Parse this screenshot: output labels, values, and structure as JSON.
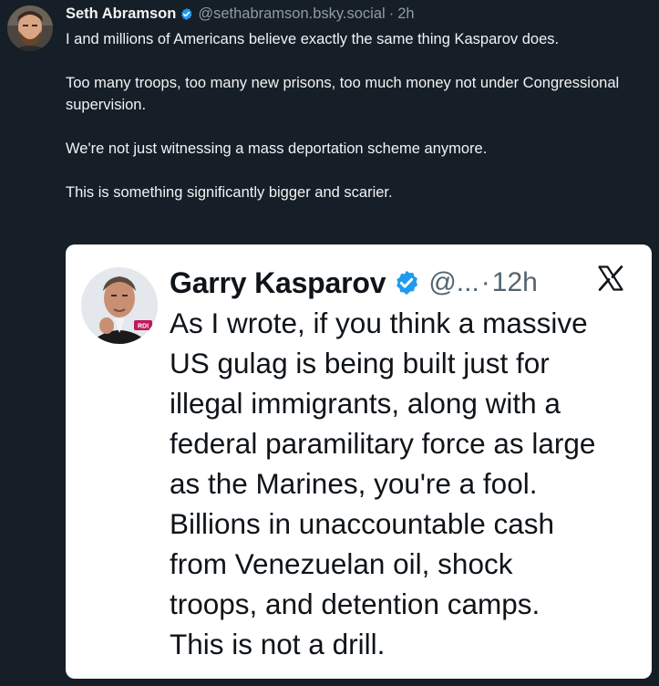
{
  "post": {
    "author": {
      "display_name": "Seth Abramson",
      "handle": "@sethabramson.bsky.social",
      "separator": "·",
      "time": "2h",
      "verified": true
    },
    "paragraphs": [
      "I and millions of Americans believe exactly the same thing Kasparov does.",
      "Too many troops, too many new prisons, too much money not under Congressional supervision.",
      "We're not just witnessing a mass deportation scheme anymore.",
      "This is something significantly bigger and scarier."
    ]
  },
  "quoted_post": {
    "author": {
      "display_name": "Garry Kasparov",
      "handle": "@...",
      "separator": "·",
      "time": "12h",
      "verified": true,
      "avatar_badge": "RDI"
    },
    "platform_icon": "x-logo-icon",
    "text_lines": [
      "As I wrote, if you think a massive",
      "US gulag is being built just for",
      "illegal immigrants, along with a",
      "federal paramilitary force as large",
      "as the Marines, you're a fool.",
      "Billions in unaccountable cash",
      "from Venezuelan oil, shock",
      "troops, and detention camps.",
      "This is not a drill."
    ]
  },
  "colors": {
    "background": "#161e27",
    "primary_text": "#f1f3f5",
    "secondary_text": "#8d9aa8",
    "verified_blue": "#1d9bf0",
    "card_background": "#ffffff",
    "card_text": "#0f1419",
    "card_secondary_text": "#536471"
  }
}
